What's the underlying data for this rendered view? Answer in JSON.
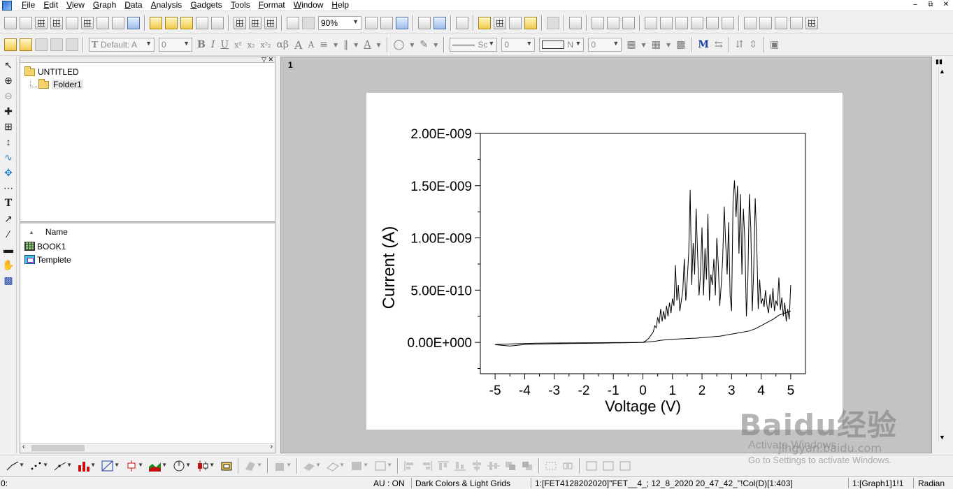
{
  "menu": [
    "File",
    "Edit",
    "View",
    "Graph",
    "Data",
    "Analysis",
    "Gadgets",
    "Tools",
    "Format",
    "Window",
    "Help"
  ],
  "window_controls": [
    "–",
    "⧉",
    "✕"
  ],
  "toolbar": {
    "zoom": "90%",
    "font_name": "Default: A",
    "font_size": "0",
    "line_style": "Sc",
    "line_width": "0",
    "fill_label": "N",
    "fill_width": "0",
    "bold": "B",
    "italic": "I",
    "underline": "U",
    "superscript": "x²",
    "subscript": "x₂",
    "supersub": "x²₂",
    "greek": "αβ",
    "font_larger": "A",
    "font_smaller": "A"
  },
  "explorer": {
    "root_folder": "UNTITLED",
    "child_folder": "Folder1",
    "list_header": "Name",
    "items": [
      {
        "name": "BOOK1",
        "type": "book"
      },
      {
        "name": "Templete",
        "type": "graph"
      }
    ]
  },
  "graph_window": {
    "number": "1"
  },
  "chart_data": {
    "type": "line",
    "title": "",
    "xlabel": "Voltage (V)",
    "ylabel": "Current (A)",
    "xlim": [
      -5.5,
      5.5
    ],
    "ylim": [
      -3e-10,
      2e-09
    ],
    "xticks": [
      -5,
      -4,
      -3,
      -2,
      -1,
      0,
      1,
      2,
      3,
      4,
      5
    ],
    "xtick_labels": [
      "-5",
      "-4",
      "-3",
      "-2",
      "-1",
      "0",
      "1",
      "2",
      "3",
      "4",
      "5"
    ],
    "yticks": [
      0,
      5e-10,
      1e-09,
      1.5e-09,
      2e-09
    ],
    "ytick_labels": [
      "0.00E+000",
      "5.00E-010",
      "1.00E-009",
      "1.50E-009",
      "2.00E-009"
    ],
    "grid": false,
    "legend": "none",
    "line_color": "#000000",
    "series": [
      {
        "x": [
          -5.0,
          -4.5,
          -4.0,
          -3.5,
          -3.0,
          -2.5,
          -2.0,
          -1.5,
          -1.0,
          -0.5,
          0.0,
          0.2,
          0.4,
          0.5,
          0.6,
          0.8,
          1.0,
          1.2,
          1.4,
          1.6,
          1.8,
          2.0,
          2.2,
          2.4,
          2.6,
          2.8,
          3.0,
          3.2,
          3.4,
          3.6,
          3.8,
          4.0,
          4.2,
          4.4,
          4.6,
          4.8,
          5.0
        ],
        "y": [
          -2e-11,
          -1.5e-11,
          -1e-11,
          -8e-12,
          -6e-12,
          -5e-12,
          -4e-12,
          -3e-12,
          -2e-12,
          -1e-12,
          0.0,
          5e-12,
          1e-11,
          1.5e-11,
          2e-11,
          2.5e-11,
          3e-11,
          3.2e-11,
          3.5e-11,
          3.8e-11,
          4e-11,
          4.5e-11,
          5e-11,
          5.5e-11,
          6e-11,
          7e-11,
          8e-11,
          9e-11,
          1e-10,
          1.1e-10,
          1.3e-10,
          1.6e-10,
          1.9e-10,
          2.2e-10,
          2.6e-10,
          2.8e-10,
          3e-10
        ]
      },
      {
        "x": [
          5.0,
          4.95,
          4.9,
          4.85,
          4.8,
          4.75,
          4.7,
          4.65,
          4.6,
          4.55,
          4.5,
          4.45,
          4.4,
          4.35,
          4.3,
          4.25,
          4.2,
          4.15,
          4.1,
          4.05,
          4.0,
          3.95,
          3.9,
          3.85,
          3.8,
          3.75,
          3.7,
          3.65,
          3.6,
          3.55,
          3.5,
          3.45,
          3.4,
          3.35,
          3.3,
          3.25,
          3.2,
          3.15,
          3.1,
          3.05,
          3.0,
          2.95,
          2.9,
          2.85,
          2.8,
          2.75,
          2.7,
          2.65,
          2.6,
          2.55,
          2.5,
          2.45,
          2.4,
          2.35,
          2.3,
          2.25,
          2.2,
          2.15,
          2.1,
          2.05,
          2.0,
          1.95,
          1.9,
          1.85,
          1.8,
          1.75,
          1.7,
          1.65,
          1.6,
          1.55,
          1.5,
          1.45,
          1.4,
          1.35,
          1.3,
          1.25,
          1.2,
          1.15,
          1.1,
          1.05,
          1.0,
          0.95,
          0.9,
          0.85,
          0.8,
          0.75,
          0.7,
          0.65,
          0.6,
          0.55,
          0.5,
          0.45,
          0.4,
          0.35,
          0.3,
          0.2,
          0.1,
          0.0,
          -0.5,
          -1.0,
          -1.5,
          -2.0,
          -2.5,
          -3.0,
          -3.5,
          -4.0,
          -4.5,
          -5.0
        ],
        "y": [
          5.5e-10,
          2.2e-10,
          3.2e-10,
          2e-10,
          3.8e-10,
          2.5e-10,
          4.3e-10,
          3.1e-10,
          6.2e-10,
          3.5e-10,
          4e-10,
          3e-10,
          5.2e-10,
          3.3e-10,
          4.6e-10,
          2.8e-10,
          3.5e-10,
          5e-10,
          3.4e-10,
          4.2e-10,
          3.7e-10,
          6e-10,
          3.2e-10,
          9.5e-10,
          1.38e-09,
          7e-10,
          3e-10,
          1.1e-09,
          1.42e-09,
          6e-10,
          2.5e-10,
          9.8e-10,
          1.28e-09,
          6.5e-10,
          1.42e-09,
          8.5e-10,
          1.5e-09,
          1.2e-09,
          1.55e-09,
          1.35e-09,
          3e-10,
          4.5e-10,
          1.15e-09,
          6.5e-10,
          9.5e-10,
          1.3e-09,
          8e-10,
          5.5e-10,
          3.5e-10,
          7.5e-10,
          1e-09,
          4.5e-10,
          8e-10,
          5.5e-10,
          6.5e-10,
          4e-10,
          1.23e-09,
          6e-10,
          9e-10,
          4.5e-10,
          1.1e-09,
          6.5e-10,
          4.5e-10,
          8.5e-10,
          1.28e-09,
          6.5e-10,
          9.5e-10,
          5.5e-10,
          1.46e-09,
          8.5e-10,
          6e-10,
          4e-10,
          8e-10,
          5e-10,
          4e-10,
          3e-10,
          5.5e-10,
          4e-10,
          7.4e-10,
          3.5e-10,
          4.2e-10,
          2.8e-10,
          3.8e-10,
          2.5e-10,
          3.5e-10,
          2.2e-10,
          3e-10,
          2e-10,
          3.2e-10,
          1.8e-10,
          2.4e-10,
          1.4e-10,
          1.6e-10,
          1e-10,
          8e-11,
          4e-11,
          1.5e-11,
          0.0,
          -3e-12,
          -5e-12,
          -7e-12,
          -9e-12,
          -1.1e-11,
          -1.3e-11,
          -1.6e-11,
          -2e-11,
          -3.5e-11,
          -2.2e-11
        ]
      }
    ]
  },
  "status": {
    "left": "0:",
    "au": "AU : ON",
    "theme": "Dark Colors & Light Grids",
    "dataset": "1:[FET4128202020]\"FET__4_; 12_8_2020 20_47_42_\"!Col(D)[1:403]",
    "layer": "1:[Graph1]1!1",
    "angle": "Radian"
  },
  "watermark": {
    "brand": "Baidu经验",
    "site": "jingyan.baidu.com",
    "activate_title": "Activate Windows",
    "activate_sub": "Go to Settings to activate Windows."
  }
}
